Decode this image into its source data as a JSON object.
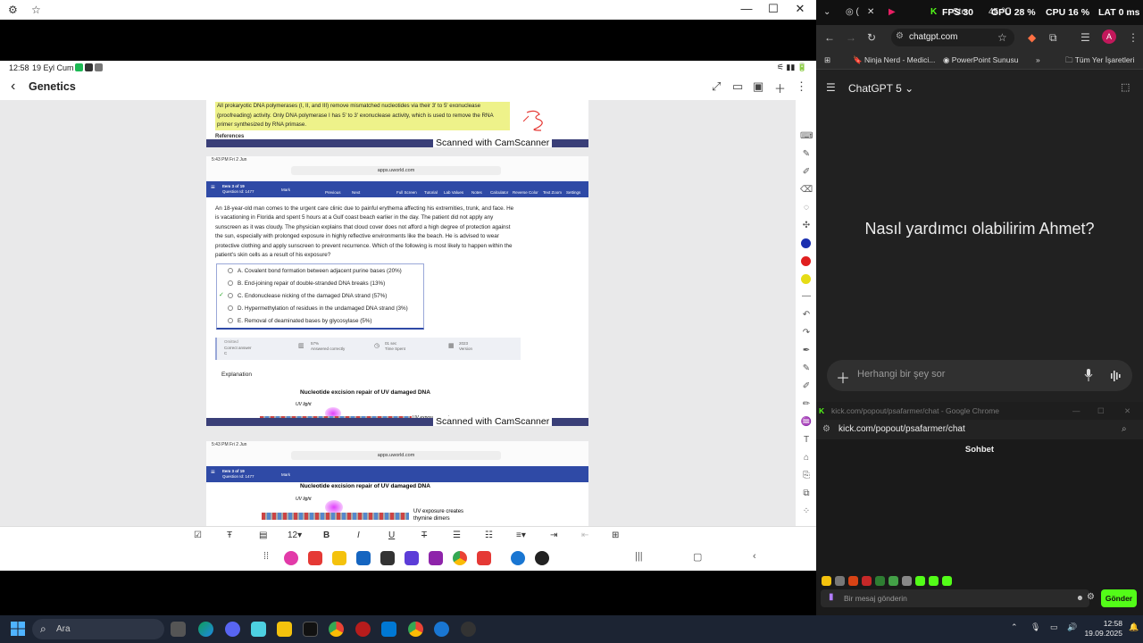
{
  "phone": {
    "status_time": "12:58",
    "status_date": "19 Eyl Cum",
    "note_title": "Genetics",
    "page1": {
      "highlight_text": "All prokaryotic DNA polymerases (I, II, and III) remove mismatched nucleotides via their 3' to 5' exonuclease (proofreading) activity.  Only DNA polymerase I has 5' to 3' exonuclease activity, which is used to remove the RNA primer synthesized by RNA primase.",
      "references": "References",
      "camscanner": "Scanned with CamScanner"
    },
    "page2": {
      "ipad_time": "5:43 PM  Fri 2 Jun",
      "url": "apps.uworld.com",
      "item_label": "Item 3 of 19",
      "question_id": "Question Id: 1477",
      "mark": "Mark",
      "previous": "Previous",
      "next": "Next",
      "toolbar_items": [
        "Full Screen",
        "Tutorial",
        "Lab Values",
        "Notes",
        "Calculator",
        "Reverse Color",
        "Text Zoom",
        "Settings"
      ],
      "question": "An 18-year-old man comes to the urgent care clinic due to painful erythema affecting his extremities, trunk, and face.  He is vacationing in Florida and spent 5 hours at a Gulf coast beach earlier in the day.  The patient did not apply any sunscreen as it was cloudy.  The physician explains that cloud cover does not afford a high degree of protection against the sun, especially with prolonged exposure in highly reflective environments like the beach.  He is advised to wear protective clothing and apply sunscreen to prevent recurrence.  Which of the following is most likely to happen within the patient's skin cells as a result of his exposure?",
      "choices": [
        "A.  Covalent bond formation between adjacent purine bases (20%)",
        "B.  End-joining repair of double-stranded DNA breaks (13%)",
        "C.  Endonuclease nicking of the damaged DNA strand (57%)",
        "D.  Hypermethylation of residues in the undamaged DNA strand (3%)",
        "E.  Removal of deaminated bases by glycosylase (5%)"
      ],
      "stats": {
        "omitted": "Omitted",
        "correct_answer_label": "Correct answer",
        "correct_answer": "C",
        "percent": "57%",
        "percent_label": "Answered correctly",
        "time": "01 sec",
        "time_label": "Time Spent",
        "version": "2023",
        "version_label": "Version"
      },
      "explanation": "Explanation",
      "figure_title": "Nucleotide excision repair of UV damaged DNA",
      "uv_light": "UV light",
      "uv_exposure": "UV exposure creates",
      "camscanner": "Scanned with CamScanner"
    },
    "page3": {
      "ipad_time": "5:43 PM  Fri 2 Jun",
      "url": "apps.uworld.com",
      "item_label": "Item 3 of 19",
      "question_id": "Question Id: 1477",
      "mark": "Mark",
      "figure_title": "Nucleotide excision repair of UV damaged DNA",
      "uv_light": "UV light",
      "uv_exposure": "UV exposure creates",
      "thymine_dimers": "thymine dimers"
    },
    "font_size": "12"
  },
  "chrome": {
    "overlay": {
      "fps_label": "FPS",
      "fps": "30",
      "gpu_label": "GPU",
      "gpu": "28 %",
      "cpu_label": "CPU",
      "cpu": "16 %",
      "lat_label": "LAT",
      "lat": "0 ms"
    },
    "tab_1": "Ste",
    "tab_2": "45 ℃",
    "url": "chatgpt.com",
    "bookmarks": [
      "Ninja Nerd - Medici...",
      "PowerPoint Sunusu"
    ],
    "all_bookmarks": "Tüm Yer İşaretleri",
    "model": "ChatGPT 5",
    "greeting": "Nasıl yardımcı olabilirim Ahmet?",
    "composer_placeholder": "Herhangi bir şey sor",
    "avatar_letter": "A"
  },
  "kick": {
    "window_title": "kick.com/popout/psafarmer/chat - Google Chrome",
    "url": "kick.com/popout/psafarmer/chat",
    "chat_header": "Sohbet",
    "input_placeholder": "Bir mesaj gönderin",
    "send": "Gönder"
  },
  "taskbar": {
    "search": "Ara",
    "time": "12:58",
    "date": "19.09.2025"
  },
  "colors": {
    "uworld_blue": "#2f4aa6",
    "highlight": "#eef28a",
    "kick_green": "#53fc18",
    "chat_bg": "#212121"
  }
}
